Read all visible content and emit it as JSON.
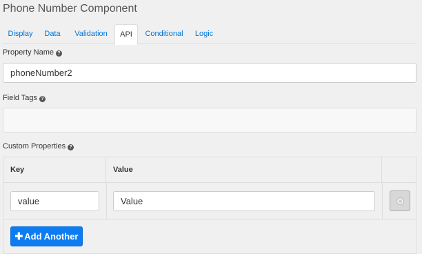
{
  "title": "Phone Number Component",
  "tabs": [
    {
      "label": "Display"
    },
    {
      "label": "Data"
    },
    {
      "label": "Validation"
    },
    {
      "label": "API"
    },
    {
      "label": "Conditional"
    },
    {
      "label": "Logic"
    }
  ],
  "active_tab": "API",
  "property_name": {
    "label": "Property Name",
    "value": "phoneNumber2"
  },
  "field_tags": {
    "label": "Field Tags",
    "value": ""
  },
  "custom_properties": {
    "label": "Custom Properties",
    "headers": {
      "key": "Key",
      "value": "Value"
    },
    "rows": [
      {
        "key": "value",
        "value": "Value"
      }
    ],
    "add_label": "Add Another"
  },
  "colors": {
    "accent": "#0275d8",
    "button": "#0d7cf2"
  },
  "icons": {
    "help": "question-circle-icon",
    "remove": "remove-row-icon",
    "add": "plus-icon"
  }
}
